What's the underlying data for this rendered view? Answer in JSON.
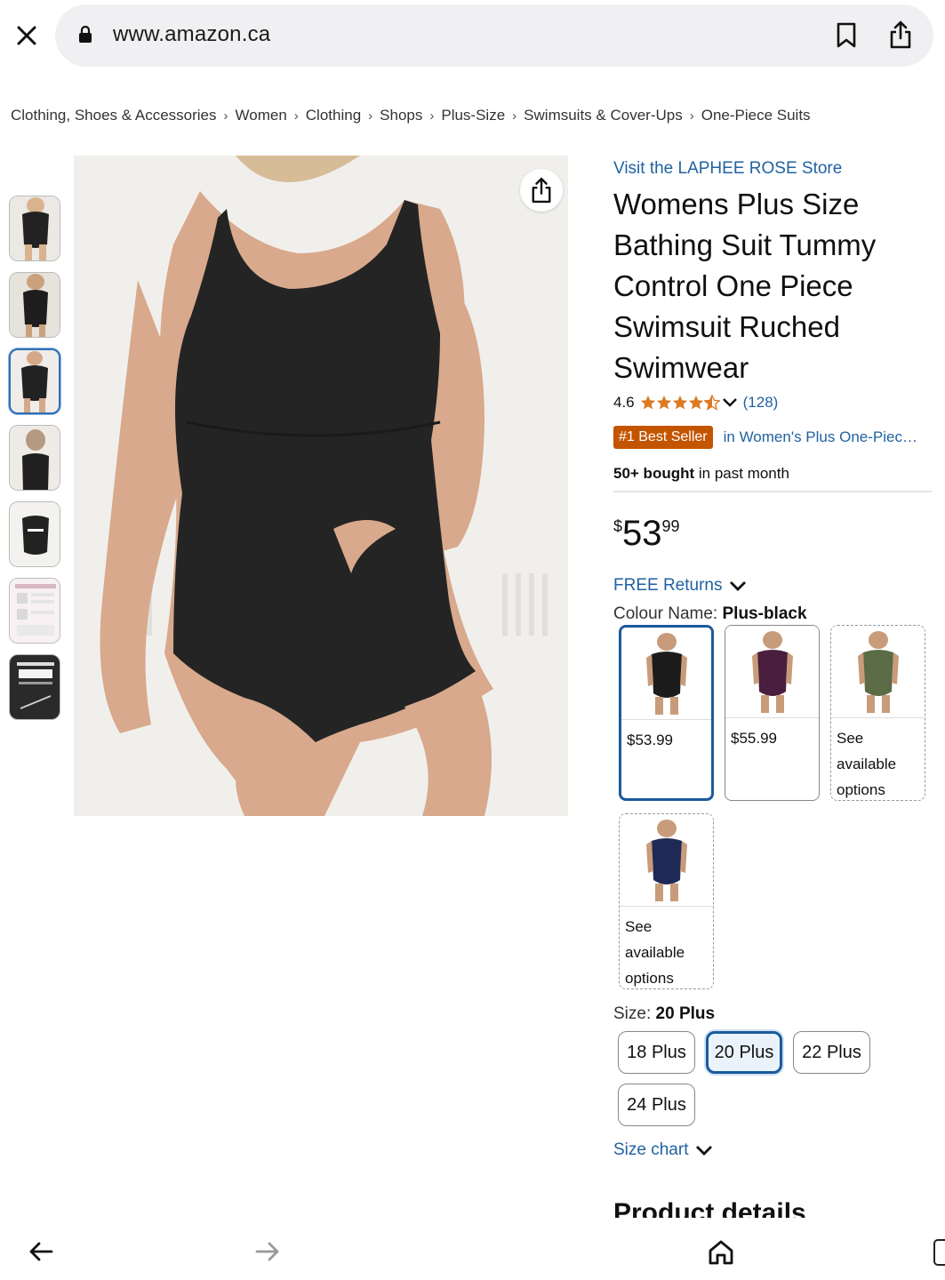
{
  "browser": {
    "url": "www.amazon.ca"
  },
  "breadcrumb": [
    "Clothing, Shoes & Accessories",
    "Women",
    "Clothing",
    "Shops",
    "Plus-Size",
    "Swimsuits & Cover-Ups",
    "One-Piece Suits"
  ],
  "product": {
    "store_link": "Visit the LAPHEE ROSE Store",
    "title": "Womens Plus Size Bathing Suit Tummy Control One Piece Swimsuit Ruched Swimwear",
    "rating": "4.6",
    "rating_stars": 4.5,
    "rating_count": "(128)",
    "badge": "#1 Best Seller",
    "badge_category": "in Women's Plus One-Piece Swimsuits",
    "bought_bold": "50+ bought",
    "bought_rest": " in past month",
    "price_currency": "$",
    "price_whole": "53",
    "price_fraction": "99",
    "returns": "FREE Returns",
    "colour_label": "Colour Name: ",
    "colour_value": "Plus-black",
    "swatches": [
      {
        "text": "$53.99",
        "color": "#1c1c1c",
        "selected": true
      },
      {
        "text": "$55.99",
        "color": "#4a1e3e",
        "selected": false
      },
      {
        "text": "See available options",
        "color": "#5a6b45",
        "selected": false
      },
      {
        "text": "See available options",
        "color": "#1e2a55",
        "selected": false
      }
    ],
    "size_label": "Size: ",
    "size_value": "20 Plus",
    "sizes": [
      "18 Plus",
      "20 Plus",
      "22 Plus",
      "24 Plus"
    ],
    "size_chart": "Size chart",
    "section_heading": "Product details"
  },
  "colors": {
    "link": "#2162a1",
    "badge": "#c45500",
    "star": "#de7921",
    "selected_border": "#1a5a9c"
  }
}
